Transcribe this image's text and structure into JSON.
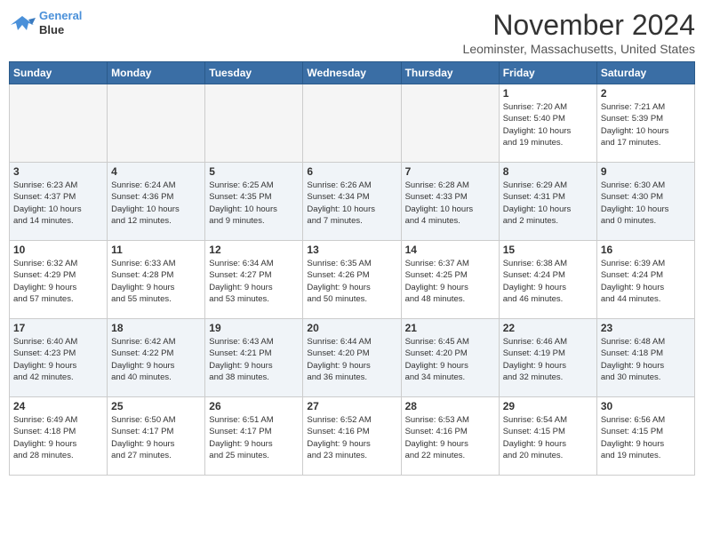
{
  "logo": {
    "line1": "General",
    "line2": "Blue"
  },
  "title": "November 2024",
  "location": "Leominster, Massachusetts, United States",
  "days_of_week": [
    "Sunday",
    "Monday",
    "Tuesday",
    "Wednesday",
    "Thursday",
    "Friday",
    "Saturday"
  ],
  "weeks": [
    [
      {
        "day": "",
        "info": ""
      },
      {
        "day": "",
        "info": ""
      },
      {
        "day": "",
        "info": ""
      },
      {
        "day": "",
        "info": ""
      },
      {
        "day": "",
        "info": ""
      },
      {
        "day": "1",
        "info": "Sunrise: 7:20 AM\nSunset: 5:40 PM\nDaylight: 10 hours\nand 19 minutes."
      },
      {
        "day": "2",
        "info": "Sunrise: 7:21 AM\nSunset: 5:39 PM\nDaylight: 10 hours\nand 17 minutes."
      }
    ],
    [
      {
        "day": "3",
        "info": "Sunrise: 6:23 AM\nSunset: 4:37 PM\nDaylight: 10 hours\nand 14 minutes."
      },
      {
        "day": "4",
        "info": "Sunrise: 6:24 AM\nSunset: 4:36 PM\nDaylight: 10 hours\nand 12 minutes."
      },
      {
        "day": "5",
        "info": "Sunrise: 6:25 AM\nSunset: 4:35 PM\nDaylight: 10 hours\nand 9 minutes."
      },
      {
        "day": "6",
        "info": "Sunrise: 6:26 AM\nSunset: 4:34 PM\nDaylight: 10 hours\nand 7 minutes."
      },
      {
        "day": "7",
        "info": "Sunrise: 6:28 AM\nSunset: 4:33 PM\nDaylight: 10 hours\nand 4 minutes."
      },
      {
        "day": "8",
        "info": "Sunrise: 6:29 AM\nSunset: 4:31 PM\nDaylight: 10 hours\nand 2 minutes."
      },
      {
        "day": "9",
        "info": "Sunrise: 6:30 AM\nSunset: 4:30 PM\nDaylight: 10 hours\nand 0 minutes."
      }
    ],
    [
      {
        "day": "10",
        "info": "Sunrise: 6:32 AM\nSunset: 4:29 PM\nDaylight: 9 hours\nand 57 minutes."
      },
      {
        "day": "11",
        "info": "Sunrise: 6:33 AM\nSunset: 4:28 PM\nDaylight: 9 hours\nand 55 minutes."
      },
      {
        "day": "12",
        "info": "Sunrise: 6:34 AM\nSunset: 4:27 PM\nDaylight: 9 hours\nand 53 minutes."
      },
      {
        "day": "13",
        "info": "Sunrise: 6:35 AM\nSunset: 4:26 PM\nDaylight: 9 hours\nand 50 minutes."
      },
      {
        "day": "14",
        "info": "Sunrise: 6:37 AM\nSunset: 4:25 PM\nDaylight: 9 hours\nand 48 minutes."
      },
      {
        "day": "15",
        "info": "Sunrise: 6:38 AM\nSunset: 4:24 PM\nDaylight: 9 hours\nand 46 minutes."
      },
      {
        "day": "16",
        "info": "Sunrise: 6:39 AM\nSunset: 4:24 PM\nDaylight: 9 hours\nand 44 minutes."
      }
    ],
    [
      {
        "day": "17",
        "info": "Sunrise: 6:40 AM\nSunset: 4:23 PM\nDaylight: 9 hours\nand 42 minutes."
      },
      {
        "day": "18",
        "info": "Sunrise: 6:42 AM\nSunset: 4:22 PM\nDaylight: 9 hours\nand 40 minutes."
      },
      {
        "day": "19",
        "info": "Sunrise: 6:43 AM\nSunset: 4:21 PM\nDaylight: 9 hours\nand 38 minutes."
      },
      {
        "day": "20",
        "info": "Sunrise: 6:44 AM\nSunset: 4:20 PM\nDaylight: 9 hours\nand 36 minutes."
      },
      {
        "day": "21",
        "info": "Sunrise: 6:45 AM\nSunset: 4:20 PM\nDaylight: 9 hours\nand 34 minutes."
      },
      {
        "day": "22",
        "info": "Sunrise: 6:46 AM\nSunset: 4:19 PM\nDaylight: 9 hours\nand 32 minutes."
      },
      {
        "day": "23",
        "info": "Sunrise: 6:48 AM\nSunset: 4:18 PM\nDaylight: 9 hours\nand 30 minutes."
      }
    ],
    [
      {
        "day": "24",
        "info": "Sunrise: 6:49 AM\nSunset: 4:18 PM\nDaylight: 9 hours\nand 28 minutes."
      },
      {
        "day": "25",
        "info": "Sunrise: 6:50 AM\nSunset: 4:17 PM\nDaylight: 9 hours\nand 27 minutes."
      },
      {
        "day": "26",
        "info": "Sunrise: 6:51 AM\nSunset: 4:17 PM\nDaylight: 9 hours\nand 25 minutes."
      },
      {
        "day": "27",
        "info": "Sunrise: 6:52 AM\nSunset: 4:16 PM\nDaylight: 9 hours\nand 23 minutes."
      },
      {
        "day": "28",
        "info": "Sunrise: 6:53 AM\nSunset: 4:16 PM\nDaylight: 9 hours\nand 22 minutes."
      },
      {
        "day": "29",
        "info": "Sunrise: 6:54 AM\nSunset: 4:15 PM\nDaylight: 9 hours\nand 20 minutes."
      },
      {
        "day": "30",
        "info": "Sunrise: 6:56 AM\nSunset: 4:15 PM\nDaylight: 9 hours\nand 19 minutes."
      }
    ]
  ]
}
